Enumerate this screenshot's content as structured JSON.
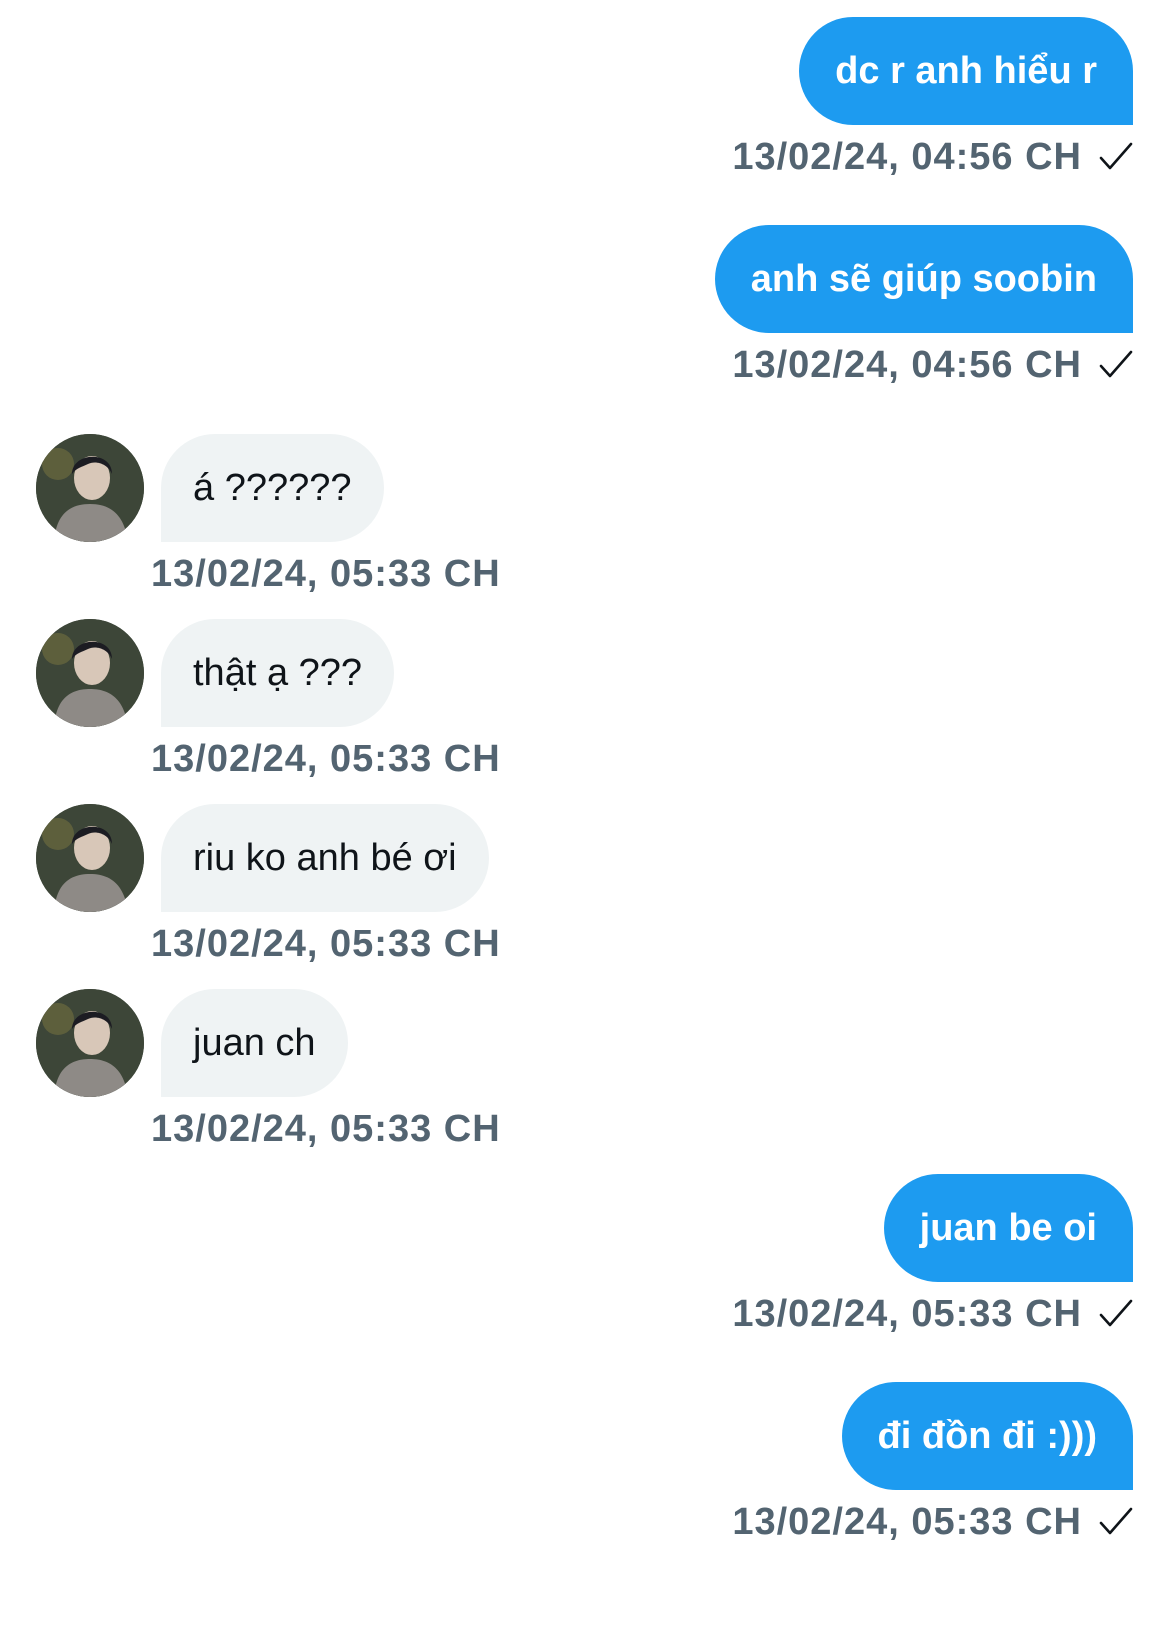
{
  "messages": [
    {
      "direction": "outgoing",
      "text": "dc r anh hiểu r",
      "timestamp": "13/02/24, 04:56 CH",
      "status_icon": "check-icon"
    },
    {
      "direction": "outgoing",
      "text": "anh sẽ giúp soobin",
      "timestamp": "13/02/24, 04:56 CH",
      "status_icon": "check-icon"
    },
    {
      "direction": "incoming",
      "text": "á ??????",
      "timestamp": "13/02/24, 05:33 CH",
      "avatar_icon": "avatar"
    },
    {
      "direction": "incoming",
      "text": "thật ạ ???",
      "timestamp": "13/02/24, 05:33 CH",
      "avatar_icon": "avatar"
    },
    {
      "direction": "incoming",
      "text": "riu ko anh bé ơi",
      "timestamp": "13/02/24, 05:33 CH",
      "avatar_icon": "avatar"
    },
    {
      "direction": "incoming",
      "text": "juan ch",
      "timestamp": "13/02/24, 05:33 CH",
      "avatar_icon": "avatar"
    },
    {
      "direction": "outgoing",
      "text": "juan be oi",
      "timestamp": "13/02/24, 05:33 CH",
      "status_icon": "check-icon"
    },
    {
      "direction": "outgoing",
      "text": "đi đồn đi :)))",
      "timestamp": "13/02/24, 05:33 CH",
      "status_icon": "check-icon"
    }
  ],
  "colors": {
    "outgoing_bubble": "#1d9bf0",
    "incoming_bubble": "#eff3f4",
    "timestamp": "#536471",
    "incoming_text": "#0f1419",
    "outgoing_text": "#ffffff"
  }
}
